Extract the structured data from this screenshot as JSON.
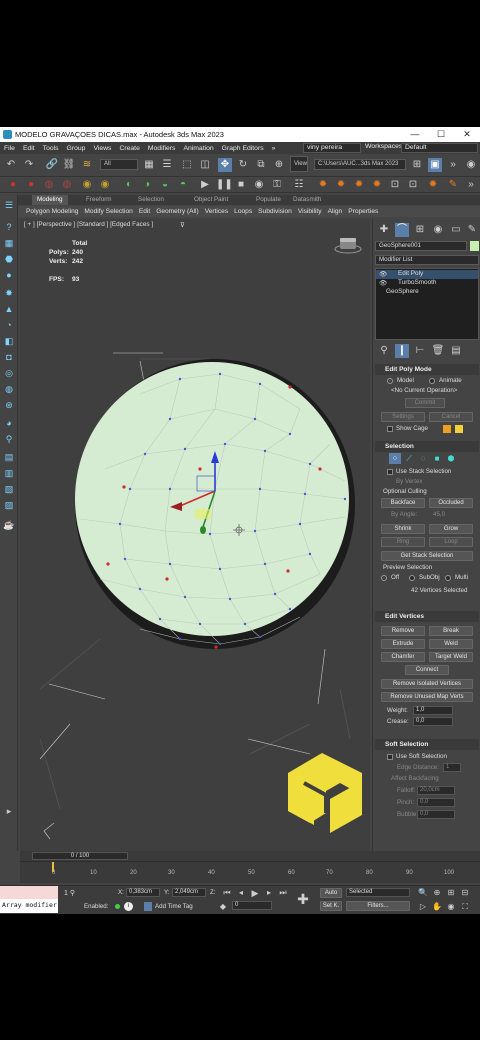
{
  "window": {
    "title": "MODELO GRAVAÇOES DICAS.max - Autodesk 3ds Max 2023",
    "controls": [
      "—",
      "☐",
      "✕"
    ]
  },
  "menu": {
    "items": [
      "File",
      "Edit",
      "Tools",
      "Group",
      "Views",
      "Create",
      "Modifiers",
      "Animation",
      "Graph Editors"
    ],
    "overflow": "»",
    "user": "viny pereira",
    "workspaces_label": "Workspaces:",
    "workspace_value": "Default"
  },
  "toolbar": {
    "selection_filter": "All",
    "view_label": "View",
    "path": "C:\\Users\\AUC...3ds Max 2023"
  },
  "ribbon": {
    "tabs": [
      "Modeling",
      "Freeform",
      "Selection",
      "Object Paint",
      "Populate",
      "Datasmith"
    ],
    "sub_items": [
      "Polygon Modeling",
      "Modify Selection",
      "Edit",
      "Geometry (All)",
      "Vertices",
      "Loops",
      "Subdivision",
      "Visibility",
      "Align",
      "Properties"
    ]
  },
  "viewport": {
    "label": "[ + ] [Perspective ] [Standard ] [Edged Faces ]",
    "stats": {
      "total_label": "Total",
      "polys_label": "Polys:",
      "polys": "240",
      "verts_label": "Verts:",
      "verts": "242",
      "fps_label": "FPS:",
      "fps": "93"
    }
  },
  "command_panel": {
    "object_name": "GeoSphere001",
    "modifier_list": "Modifier List",
    "stack": [
      "Edit Poly",
      "TurboSmooth",
      "GeoSphere"
    ],
    "edit_poly_mode": {
      "title": "Edit Poly Mode",
      "model": "Model",
      "animate": "Animate",
      "current_op": "<No Current Operation>",
      "commit": "Commit",
      "settings": "Settings",
      "cancel": "Cancel",
      "show_cage": "Show Cage"
    },
    "selection": {
      "title": "Selection",
      "use_stack": "Use Stack Selection",
      "by_vertex": "By Vertex",
      "culling": "Optional Culling",
      "backface": "Backface",
      "occluded": "Occluded",
      "by_angle": "By Angle:",
      "angle": "45,0",
      "shrink": "Shrink",
      "grow": "Grow",
      "ring": "Ring",
      "loop": "Loop",
      "get_stack": "Get Stack Selection",
      "preview": "Preview Selection",
      "off": "Off",
      "subobj": "SubObj",
      "multi": "Multi",
      "selected_count": "42 Vertices Selected"
    },
    "edit_vertices": {
      "title": "Edit Vertices",
      "remove": "Remove",
      "break": "Break",
      "extrude": "Extrude",
      "weld": "Weld",
      "chamfer": "Chamfer",
      "target_weld": "Target Weld",
      "connect": "Connect",
      "remove_isolated": "Remove Isolated Vertices",
      "remove_unused": "Remove Unused Map Verts",
      "weight_label": "Weight:",
      "weight": "1,0",
      "crease_label": "Crease:",
      "crease": "0,0"
    },
    "soft_selection": {
      "title": "Soft Selection",
      "use_soft": "Use Soft Selection",
      "edge_distance": "Edge Distance:",
      "edge_val": "1",
      "affect_backfacing": "Affect Backfacing",
      "falloff": "Falloff:",
      "falloff_val": "20,0cm",
      "pinch": "Pinch:",
      "pinch_val": "0,0",
      "bubble": "Bubble:",
      "bubble_val": "0,0"
    }
  },
  "timeline": {
    "frame": "0 / 100",
    "ticks": [
      "0",
      "10",
      "20",
      "30",
      "40",
      "50",
      "60",
      "70",
      "80",
      "90",
      "100"
    ]
  },
  "status": {
    "maxscript": "Array modifier",
    "x_label": "X:",
    "x": "0,383cm",
    "y_label": "Y:",
    "y": "2,049cm",
    "z_label": "Z:",
    "enabled": "Enabled:",
    "add_time_tag": "Add Time Tag",
    "frame_value": "0",
    "auto": "Auto",
    "set_k": "Set K.",
    "selected": "Selected",
    "filters": "Filters..."
  },
  "colors": {
    "accent": "#5aa0e0",
    "sphere": "#d6ecd2",
    "logo": "#f0de3c"
  }
}
